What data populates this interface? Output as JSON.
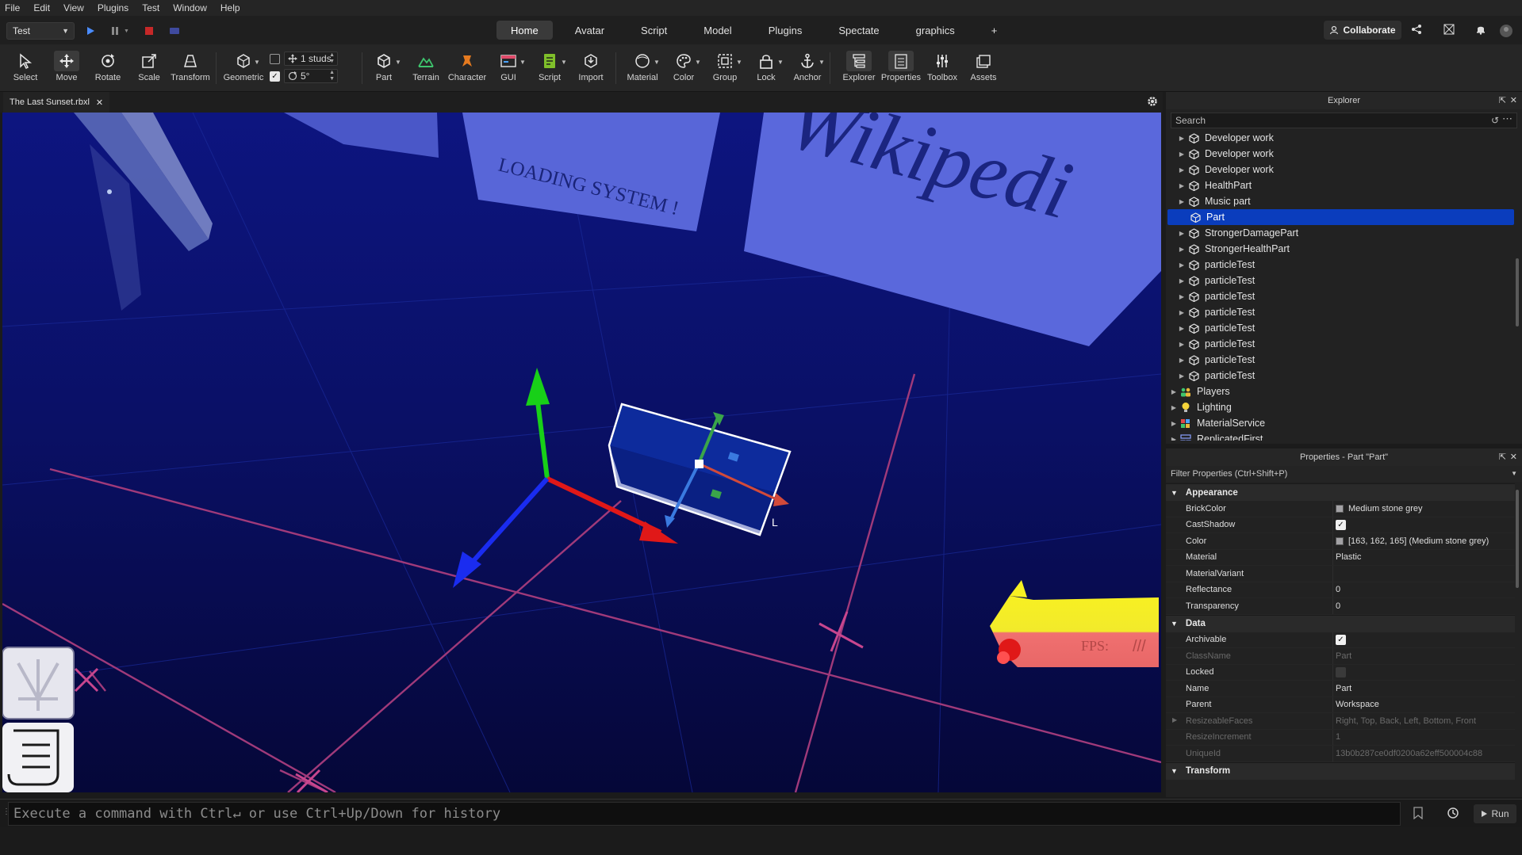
{
  "menu": [
    "File",
    "Edit",
    "View",
    "Plugins",
    "Test",
    "Window",
    "Help"
  ],
  "topbar": {
    "mode_select": "Test",
    "tabs": [
      "Home",
      "Avatar",
      "Script",
      "Model",
      "Plugins",
      "Spectate",
      "graphics"
    ],
    "active_tab": "Home",
    "add_tab": "+",
    "collaborate": "Collaborate"
  },
  "ribbon": {
    "tools": [
      "Select",
      "Move",
      "Rotate",
      "Scale",
      "Transform"
    ],
    "geometric": "Geometric",
    "snap_move": "1 studs",
    "snap_rotate": "5°",
    "insert": [
      "Part",
      "Terrain",
      "Character",
      "GUI",
      "Script",
      "Import"
    ],
    "edit": [
      "Material",
      "Color",
      "Group",
      "Lock",
      "Anchor"
    ],
    "panels": [
      "Explorer",
      "Properties",
      "Toolbox",
      "Assets"
    ]
  },
  "document_tab": "The Last Sunset.rbxl",
  "viewport": {
    "sign_loading": "LOADING SYSTEM !",
    "sign_wiki": "Wikipedi",
    "fps_label": "FPS:",
    "fps_slashes": "///",
    "axis_local": "L"
  },
  "explorer": {
    "title": "Explorer",
    "search_placeholder": "Search",
    "items": [
      {
        "label": "Developer work",
        "icon": "part-icon",
        "depth": 1
      },
      {
        "label": "Developer work",
        "icon": "part-icon",
        "depth": 1
      },
      {
        "label": "Developer work",
        "icon": "part-icon",
        "depth": 1
      },
      {
        "label": "HealthPart",
        "icon": "part-icon",
        "depth": 1
      },
      {
        "label": "Music part",
        "icon": "part-icon",
        "depth": 1
      },
      {
        "label": "Part",
        "icon": "part-icon",
        "depth": 1,
        "selected": true
      },
      {
        "label": "StrongerDamagePart",
        "icon": "part-icon",
        "depth": 1
      },
      {
        "label": "StrongerHealthPart",
        "icon": "part-icon",
        "depth": 1
      },
      {
        "label": "particleTest",
        "icon": "part-icon",
        "depth": 1
      },
      {
        "label": "particleTest",
        "icon": "part-icon",
        "depth": 1
      },
      {
        "label": "particleTest",
        "icon": "part-icon",
        "depth": 1
      },
      {
        "label": "particleTest",
        "icon": "part-icon",
        "depth": 1
      },
      {
        "label": "particleTest",
        "icon": "part-icon",
        "depth": 1
      },
      {
        "label": "particleTest",
        "icon": "part-icon",
        "depth": 1
      },
      {
        "label": "particleTest",
        "icon": "part-icon",
        "depth": 1
      },
      {
        "label": "particleTest",
        "icon": "part-icon",
        "depth": 1
      },
      {
        "label": "Players",
        "icon": "players-icon",
        "depth": 0
      },
      {
        "label": "Lighting",
        "icon": "lighting-icon",
        "depth": 0
      },
      {
        "label": "MaterialService",
        "icon": "material-service-icon",
        "depth": 0
      },
      {
        "label": "ReplicatedFirst",
        "icon": "replicated-first-icon",
        "depth": 0
      }
    ]
  },
  "properties": {
    "title": "Properties - Part \"Part\"",
    "filter_placeholder": "Filter Properties (Ctrl+Shift+P)",
    "sections": [
      {
        "name": "Appearance",
        "rows": [
          {
            "name": "BrickColor",
            "value": "Medium stone grey",
            "swatch": "#a3a2a5"
          },
          {
            "name": "CastShadow",
            "checkbox": true
          },
          {
            "name": "Color",
            "value": "[163, 162, 165] (Medium stone grey)",
            "swatch": "#a3a2a5"
          },
          {
            "name": "Material",
            "value": "Plastic"
          },
          {
            "name": "MaterialVariant",
            "value": ""
          },
          {
            "name": "Reflectance",
            "value": "0"
          },
          {
            "name": "Transparency",
            "value": "0"
          }
        ]
      },
      {
        "name": "Data",
        "rows": [
          {
            "name": "Archivable",
            "checkbox": true
          },
          {
            "name": "ClassName",
            "value": "Part",
            "readonly": true
          },
          {
            "name": "Locked",
            "checkbox": false
          },
          {
            "name": "Name",
            "value": "Part"
          },
          {
            "name": "Parent",
            "value": "Workspace"
          },
          {
            "name": "ResizeableFaces",
            "value": "Right, Top, Back, Left, Bottom, Front",
            "readonly": true,
            "expandable": true
          },
          {
            "name": "ResizeIncrement",
            "value": "1",
            "readonly": true
          },
          {
            "name": "UniqueId",
            "value": "13b0b287ce0df0200a62eff500004c88",
            "readonly": true
          }
        ]
      },
      {
        "name": "Transform",
        "rows": []
      }
    ]
  },
  "command_bar": {
    "placeholder": "Execute a command with Ctrl↵ or use Ctrl+Up/Down for history",
    "run_label": "Run"
  },
  "colors": {
    "selection_blue": "#0a3dbd",
    "viewport_bg": "#07083a",
    "axis_x": "#e01818",
    "axis_y": "#18d018",
    "axis_z": "#1a2cf0"
  }
}
